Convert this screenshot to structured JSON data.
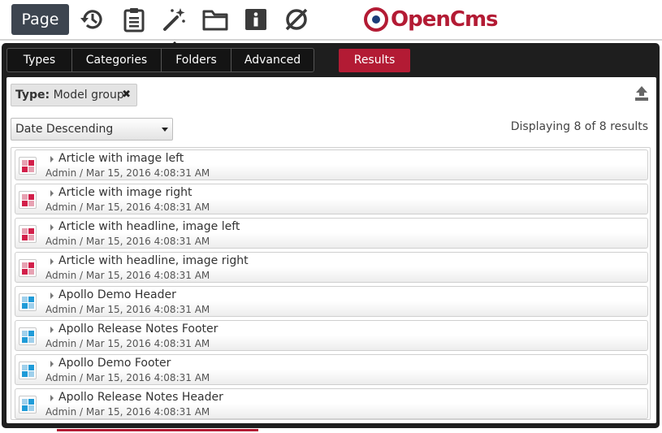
{
  "toolbar": {
    "page_label": "Page",
    "icons": [
      "history-icon",
      "clipboard-icon",
      "magic-wand-icon",
      "folder-icon",
      "info-icon",
      "eye-off-icon"
    ],
    "logo_text": "OpenCms",
    "brand_color": "#b31b34"
  },
  "tabs": [
    {
      "label": "Types"
    },
    {
      "label": "Categories"
    },
    {
      "label": "Folders"
    },
    {
      "label": "Advanced"
    }
  ],
  "results_tab": {
    "label": "Results"
  },
  "filter": {
    "key": "Type:",
    "value": "Model group"
  },
  "sort": {
    "selected": "Date Descending"
  },
  "result_count": "Displaying 8 of 8 results",
  "results": [
    {
      "title": "Article with image left",
      "meta": "Admin / Mar 15, 2016 4:08:31 AM",
      "icon": "model-group-icon-red"
    },
    {
      "title": "Article with image right",
      "meta": "Admin / Mar 15, 2016 4:08:31 AM",
      "icon": "model-group-icon-red"
    },
    {
      "title": "Article with headline, image left",
      "meta": "Admin / Mar 15, 2016 4:08:31 AM",
      "icon": "model-group-icon-red"
    },
    {
      "title": "Article with headline, image right",
      "meta": "Admin / Mar 15, 2016 4:08:31 AM",
      "icon": "model-group-icon-red"
    },
    {
      "title": "Apollo Demo Header",
      "meta": "Admin / Mar 15, 2016 4:08:31 AM",
      "icon": "model-group-icon-blue"
    },
    {
      "title": "Apollo Release Notes Footer",
      "meta": "Admin / Mar 15, 2016 4:08:31 AM",
      "icon": "model-group-icon-blue"
    },
    {
      "title": "Apollo Demo Footer",
      "meta": "Admin / Mar 15, 2016 4:08:31 AM",
      "icon": "model-group-icon-blue"
    },
    {
      "title": "Apollo Release Notes Header",
      "meta": "Admin / Mar 15, 2016 4:08:31 AM",
      "icon": "model-group-icon-blue"
    }
  ],
  "colors": {
    "red_icon": [
      "#d21f4a",
      "#e7a1b2"
    ],
    "blue_icon": [
      "#1f9bd8",
      "#9fd0ec"
    ]
  }
}
